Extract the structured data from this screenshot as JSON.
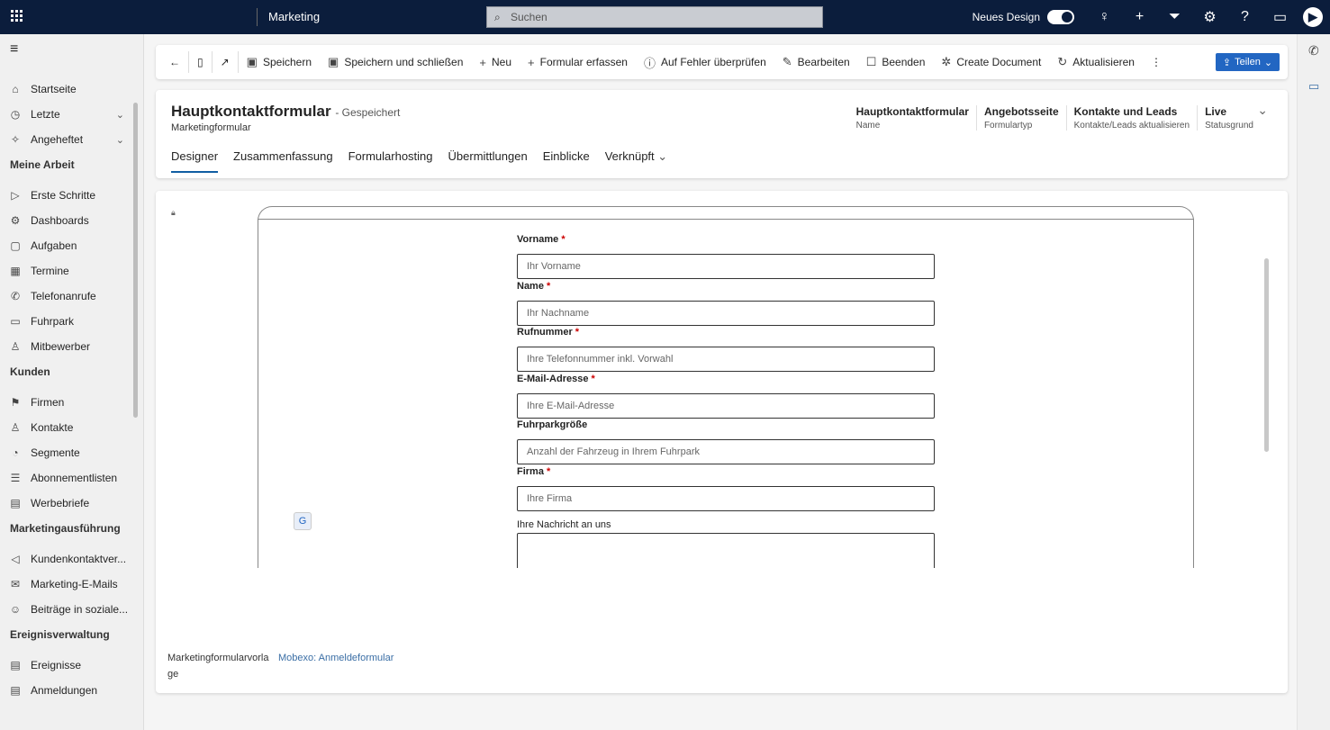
{
  "topbar": {
    "app_name": "Marketing",
    "search_placeholder": "Suchen",
    "new_design_label": "Neues Design",
    "new_design_on": true
  },
  "sidebar": {
    "top": [
      {
        "icon": "home-icon",
        "glyph": "⌂",
        "label": "Startseite"
      },
      {
        "icon": "clock-icon",
        "glyph": "◷",
        "label": "Letzte",
        "chevron": true
      },
      {
        "icon": "pin-icon",
        "glyph": "✧",
        "label": "Angeheftet",
        "chevron": true
      }
    ],
    "groups": [
      {
        "title": "Meine Arbeit",
        "items": [
          {
            "icon": "play-icon",
            "glyph": "▷",
            "label": "Erste Schritte"
          },
          {
            "icon": "dashboard-icon",
            "glyph": "⚙",
            "label": "Dashboards"
          },
          {
            "icon": "task-icon",
            "glyph": "▢",
            "label": "Aufgaben"
          },
          {
            "icon": "calendar-icon",
            "glyph": "▦",
            "label": "Termine"
          },
          {
            "icon": "phone-icon",
            "glyph": "✆",
            "label": "Telefonanrufe"
          },
          {
            "icon": "fleet-icon",
            "glyph": "▭",
            "label": "Fuhrpark"
          },
          {
            "icon": "competitor-icon",
            "glyph": "♙",
            "label": "Mitbewerber"
          }
        ]
      },
      {
        "title": "Kunden",
        "items": [
          {
            "icon": "company-icon",
            "glyph": "⚑",
            "label": "Firmen"
          },
          {
            "icon": "contact-icon",
            "glyph": "♙",
            "label": "Kontakte"
          },
          {
            "icon": "segment-icon",
            "glyph": "◔",
            "label": "Segmente"
          },
          {
            "icon": "list-icon",
            "glyph": "☰",
            "label": "Abonnementlisten"
          },
          {
            "icon": "letter-icon",
            "glyph": "▤",
            "label": "Werbebriefe"
          }
        ]
      },
      {
        "title": "Marketingausführung",
        "items": [
          {
            "icon": "journey-icon",
            "glyph": "◁",
            "label": "Kundenkontaktver..."
          },
          {
            "icon": "mail-icon",
            "glyph": "✉",
            "label": "Marketing-E-Mails"
          },
          {
            "icon": "social-icon",
            "glyph": "☺",
            "label": "Beiträge in soziale..."
          }
        ]
      },
      {
        "title": "Ereignisverwaltung",
        "items": [
          {
            "icon": "event-icon",
            "glyph": "▤",
            "label": "Ereignisse"
          },
          {
            "icon": "registration-icon",
            "glyph": "▤",
            "label": "Anmeldungen"
          }
        ]
      }
    ]
  },
  "toolbar": {
    "save": "Speichern",
    "save_close": "Speichern und schließen",
    "new": "Neu",
    "capture": "Formular erfassen",
    "check": "Auf Fehler überprüfen",
    "edit": "Bearbeiten",
    "stop": "Beenden",
    "create_doc": "Create Document",
    "refresh": "Aktualisieren",
    "share": "Teilen"
  },
  "header": {
    "title": "Hauptkontaktformular",
    "status": "- Gespeichert",
    "entity": "Marketingformular",
    "tabs": [
      "Designer",
      "Zusammenfassung",
      "Formularhosting",
      "Übermittlungen",
      "Einblicke",
      "Verknüpft"
    ],
    "fields": [
      {
        "value": "Hauptkontaktformular",
        "label": "Name"
      },
      {
        "value": "Angebotsseite",
        "label": "Formulartyp"
      },
      {
        "value": "Kontakte und Leads",
        "label": "Kontakte/Leads aktualisieren"
      },
      {
        "value": "Live",
        "label": "Statusgrund"
      }
    ]
  },
  "form": {
    "fields": [
      {
        "label": "Vorname",
        "required": "*",
        "placeholder": "Ihr Vorname"
      },
      {
        "label": "Name",
        "required": "*",
        "placeholder": "Ihr Nachname"
      },
      {
        "label": "Rufnummer",
        "required": "*",
        "placeholder": "Ihre Telefonnummer inkl. Vorwahl"
      },
      {
        "label": "E-Mail-Adresse",
        "required": "*",
        "placeholder": "Ihre E-Mail-Adresse"
      },
      {
        "label": "Fuhrparkgröße",
        "required": "",
        "placeholder": "Anzahl der Fahrzeug in Ihrem Fuhrpark"
      },
      {
        "label": "Firma",
        "required": "*",
        "placeholder": "Ihre Firma"
      }
    ],
    "message_label": "Ihre Nachricht an uns"
  },
  "footer": {
    "template_label": "Marketingformularvorlage",
    "template_value": "Mobexo: Anmeldeformular"
  }
}
